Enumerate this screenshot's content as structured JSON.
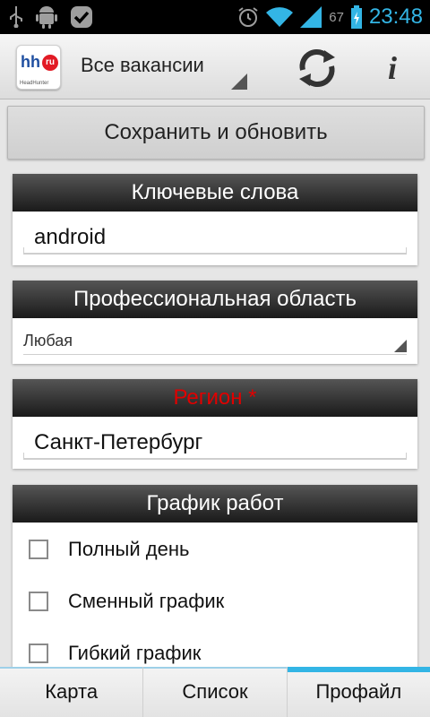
{
  "status_bar": {
    "icons": [
      "usb-icon",
      "android-icon",
      "check-icon"
    ],
    "right_icons": [
      "alarm-icon",
      "wifi-icon",
      "signal-icon",
      "battery-icon"
    ],
    "battery_percent": "67",
    "time": "23:48",
    "accent_color": "#33b5e5"
  },
  "action_bar": {
    "logo": {
      "brand": "hh",
      "badge": "ru",
      "caption": "HeadHunter"
    },
    "spinner_title": "Все вакансии",
    "refresh_icon": "refresh-icon",
    "info_label": "i"
  },
  "save_button": {
    "label": "Сохранить и обновить"
  },
  "keywords": {
    "header": "Ключевые слова",
    "value": "android"
  },
  "professional_area": {
    "header": "Профессиональная область",
    "selected": "Любая"
  },
  "region": {
    "header": "Регион *",
    "value": "Санкт-Петербург",
    "header_color": "#e00000"
  },
  "schedule": {
    "header": "График работ",
    "options": [
      {
        "label": "Полный день",
        "checked": false
      },
      {
        "label": "Сменный график",
        "checked": false
      },
      {
        "label": "Гибкий график",
        "checked": false
      }
    ]
  },
  "tabs": [
    {
      "label": "Карта",
      "active": false
    },
    {
      "label": "Список",
      "active": false
    },
    {
      "label": "Профайл",
      "active": true
    }
  ]
}
